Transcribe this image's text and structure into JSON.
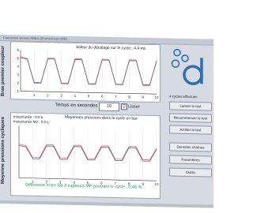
{
  "titlebar": {
    "text": "Connexion serveur Milieu (Environment CRD)"
  },
  "chart_top": {
    "ylabel": "Bras premier coupleur",
    "title": "Valeur du décalage sur le cycle : 4.4 ms"
  },
  "chart_bottom": {
    "ylabel": "Moyenne pressions cycliques",
    "title": "Moyennes pressions dans le cycle en bar",
    "instant1": "Instantanée  : 0.0 b",
    "instant2": "Instantanée  M2 : 0.0 b",
    "diff_text": "Différence entre les 2 capteurs MP pendant le cycle : 0.46 %"
  },
  "time_control": {
    "label": "Temps en secondes",
    "value": "10",
    "checkbox": "☑",
    "lisser": "Lisser"
  },
  "right_panel": {
    "cycles_text": "4 cycles effectués",
    "buttons": {
      "lancer": "Lancer le test",
      "recommencer": "Recommencer le test",
      "arreter": "Arrêter le test",
      "donnees": "Données chaînes",
      "parametres": "Paramètres",
      "outils": "Outils"
    }
  },
  "chart_data": [
    {
      "type": "line",
      "x": [
        0,
        0.5,
        1,
        1.5,
        2,
        2.5,
        3,
        3.5,
        4,
        4.5,
        5,
        5.5,
        6,
        6.5,
        7,
        7.5,
        8,
        8.5,
        9,
        9.5,
        10
      ],
      "xlim": [
        0,
        10
      ],
      "ylim": [
        1,
        6
      ],
      "x_ticks": [
        "1",
        "2",
        "3",
        "4",
        "5",
        "6",
        "7",
        "8",
        "9",
        "10"
      ],
      "y_ticks": [
        "1",
        "2",
        "3",
        "4",
        "5",
        "6"
      ],
      "series": [
        {
          "color": "#e8778a",
          "values": [
            5.2,
            5.0,
            2.0,
            2.0,
            5.1,
            5.1,
            2.0,
            2.0,
            5.1,
            5.1,
            2.0,
            2.0,
            5.1,
            5.1,
            2.0,
            2.0,
            5.1,
            5.1,
            2.0,
            2.0,
            5.1
          ]
        },
        {
          "color": "#6b7280",
          "values": [
            5.1,
            4.9,
            2.1,
            2.1,
            5.0,
            5.0,
            2.1,
            2.1,
            5.0,
            5.0,
            2.1,
            2.1,
            5.0,
            5.0,
            2.1,
            2.1,
            5.0,
            5.0,
            2.1,
            2.1,
            5.0
          ]
        }
      ]
    },
    {
      "type": "line",
      "x": [
        0,
        0.5,
        1,
        1.5,
        2,
        2.5,
        3,
        3.5,
        4,
        4.5,
        5,
        5.5,
        6,
        6.5,
        7,
        7.5,
        8,
        8.5,
        9,
        9.5,
        10
      ],
      "xlim": [
        0,
        10
      ],
      "ylim": [
        0,
        4
      ],
      "x_ticks": [
        "1",
        "2",
        "3",
        "4",
        "5",
        "6",
        "7",
        "8",
        "9",
        "10"
      ],
      "series": [
        {
          "color": "#e8778a",
          "values": [
            2.6,
            2.5,
            1.6,
            1.6,
            2.6,
            2.6,
            1.6,
            1.6,
            2.6,
            2.6,
            1.6,
            1.6,
            2.6,
            2.6,
            1.6,
            1.6,
            2.6,
            2.6,
            1.6,
            1.6,
            2.5
          ]
        },
        {
          "color": "#6b7280",
          "values": [
            2.5,
            2.4,
            1.5,
            1.5,
            2.5,
            2.5,
            1.5,
            1.5,
            2.5,
            2.5,
            1.5,
            1.5,
            2.5,
            2.5,
            1.5,
            1.5,
            2.5,
            2.5,
            1.5,
            1.5,
            2.4
          ]
        }
      ]
    }
  ]
}
